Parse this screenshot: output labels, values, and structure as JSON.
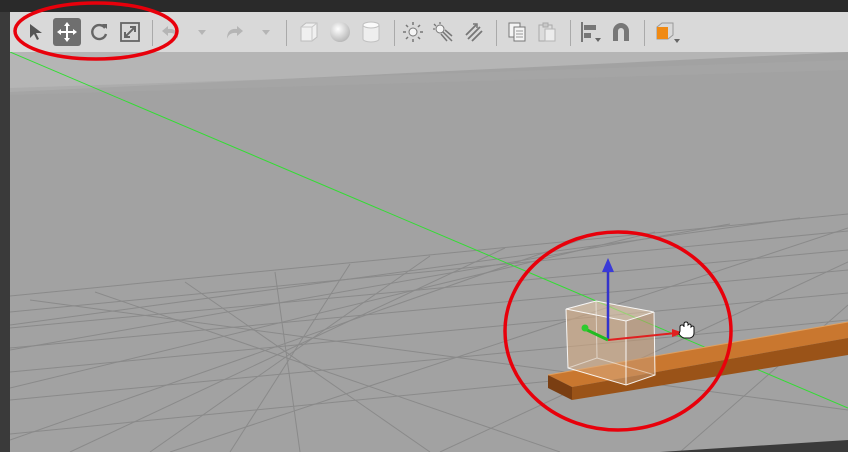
{
  "toolbar": {
    "tools": [
      {
        "name": "select-mode-icon"
      },
      {
        "name": "translate-mode-icon",
        "active": true
      },
      {
        "name": "rotate-mode-icon"
      },
      {
        "name": "scale-mode-icon"
      },
      {
        "name": "undo-icon"
      },
      {
        "name": "undo-history-dropdown-icon"
      },
      {
        "name": "redo-icon"
      },
      {
        "name": "redo-history-dropdown-icon"
      },
      {
        "name": "box-shape-icon"
      },
      {
        "name": "sphere-shape-icon"
      },
      {
        "name": "cylinder-shape-icon"
      },
      {
        "name": "point-light-icon"
      },
      {
        "name": "spot-light-icon"
      },
      {
        "name": "directional-light-icon"
      },
      {
        "name": "copy-icon"
      },
      {
        "name": "paste-icon"
      },
      {
        "name": "align-icon"
      },
      {
        "name": "snap-magnet-icon"
      },
      {
        "name": "view-angle-icon"
      }
    ]
  },
  "colors": {
    "toolbar_bg": "#d9d9d9",
    "viewport_bg": "#a3a3a3",
    "sky": "#b4b4b4",
    "grid_line": "#8a8a8a",
    "plank": "#b8682a",
    "axis_x": "#e02020",
    "axis_y": "#2ecc2e",
    "axis_z": "#3a3ad8",
    "annotation": "#e8000b"
  },
  "scene": {
    "objects": [
      {
        "name": "wooden-plank",
        "type": "box"
      },
      {
        "name": "selected-box",
        "type": "box",
        "selected": true
      }
    ],
    "annotations": [
      {
        "name": "annotation-circle-toolbar"
      },
      {
        "name": "annotation-circle-box"
      }
    ]
  }
}
